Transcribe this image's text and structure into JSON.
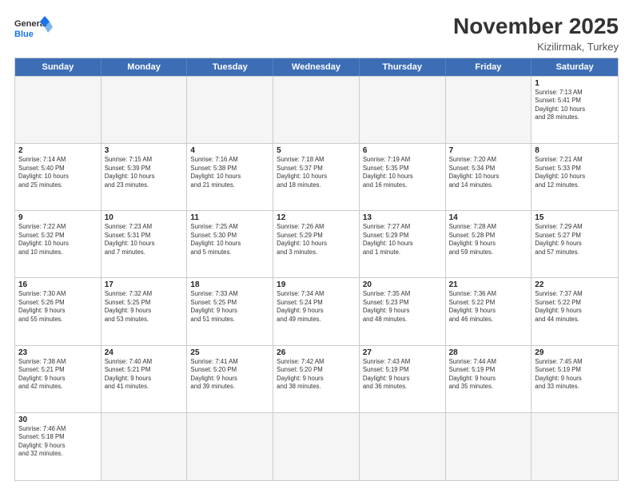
{
  "header": {
    "logo_general": "General",
    "logo_blue": "Blue",
    "month_title": "November 2025",
    "subtitle": "Kizilirmak, Turkey"
  },
  "weekdays": [
    "Sunday",
    "Monday",
    "Tuesday",
    "Wednesday",
    "Thursday",
    "Friday",
    "Saturday"
  ],
  "rows": [
    [
      {
        "day": "",
        "info": ""
      },
      {
        "day": "",
        "info": ""
      },
      {
        "day": "",
        "info": ""
      },
      {
        "day": "",
        "info": ""
      },
      {
        "day": "",
        "info": ""
      },
      {
        "day": "",
        "info": ""
      },
      {
        "day": "1",
        "info": "Sunrise: 7:13 AM\nSunset: 5:41 PM\nDaylight: 10 hours\nand 28 minutes."
      }
    ],
    [
      {
        "day": "2",
        "info": "Sunrise: 7:14 AM\nSunset: 5:40 PM\nDaylight: 10 hours\nand 25 minutes."
      },
      {
        "day": "3",
        "info": "Sunrise: 7:15 AM\nSunset: 5:39 PM\nDaylight: 10 hours\nand 23 minutes."
      },
      {
        "day": "4",
        "info": "Sunrise: 7:16 AM\nSunset: 5:38 PM\nDaylight: 10 hours\nand 21 minutes."
      },
      {
        "day": "5",
        "info": "Sunrise: 7:18 AM\nSunset: 5:37 PM\nDaylight: 10 hours\nand 18 minutes."
      },
      {
        "day": "6",
        "info": "Sunrise: 7:19 AM\nSunset: 5:35 PM\nDaylight: 10 hours\nand 16 minutes."
      },
      {
        "day": "7",
        "info": "Sunrise: 7:20 AM\nSunset: 5:34 PM\nDaylight: 10 hours\nand 14 minutes."
      },
      {
        "day": "8",
        "info": "Sunrise: 7:21 AM\nSunset: 5:33 PM\nDaylight: 10 hours\nand 12 minutes."
      }
    ],
    [
      {
        "day": "9",
        "info": "Sunrise: 7:22 AM\nSunset: 5:32 PM\nDaylight: 10 hours\nand 10 minutes."
      },
      {
        "day": "10",
        "info": "Sunrise: 7:23 AM\nSunset: 5:31 PM\nDaylight: 10 hours\nand 7 minutes."
      },
      {
        "day": "11",
        "info": "Sunrise: 7:25 AM\nSunset: 5:30 PM\nDaylight: 10 hours\nand 5 minutes."
      },
      {
        "day": "12",
        "info": "Sunrise: 7:26 AM\nSunset: 5:29 PM\nDaylight: 10 hours\nand 3 minutes."
      },
      {
        "day": "13",
        "info": "Sunrise: 7:27 AM\nSunset: 5:29 PM\nDaylight: 10 hours\nand 1 minute."
      },
      {
        "day": "14",
        "info": "Sunrise: 7:28 AM\nSunset: 5:28 PM\nDaylight: 9 hours\nand 59 minutes."
      },
      {
        "day": "15",
        "info": "Sunrise: 7:29 AM\nSunset: 5:27 PM\nDaylight: 9 hours\nand 57 minutes."
      }
    ],
    [
      {
        "day": "16",
        "info": "Sunrise: 7:30 AM\nSunset: 5:26 PM\nDaylight: 9 hours\nand 55 minutes."
      },
      {
        "day": "17",
        "info": "Sunrise: 7:32 AM\nSunset: 5:25 PM\nDaylight: 9 hours\nand 53 minutes."
      },
      {
        "day": "18",
        "info": "Sunrise: 7:33 AM\nSunset: 5:25 PM\nDaylight: 9 hours\nand 51 minutes."
      },
      {
        "day": "19",
        "info": "Sunrise: 7:34 AM\nSunset: 5:24 PM\nDaylight: 9 hours\nand 49 minutes."
      },
      {
        "day": "20",
        "info": "Sunrise: 7:35 AM\nSunset: 5:23 PM\nDaylight: 9 hours\nand 48 minutes."
      },
      {
        "day": "21",
        "info": "Sunrise: 7:36 AM\nSunset: 5:22 PM\nDaylight: 9 hours\nand 46 minutes."
      },
      {
        "day": "22",
        "info": "Sunrise: 7:37 AM\nSunset: 5:22 PM\nDaylight: 9 hours\nand 44 minutes."
      }
    ],
    [
      {
        "day": "23",
        "info": "Sunrise: 7:38 AM\nSunset: 5:21 PM\nDaylight: 9 hours\nand 42 minutes."
      },
      {
        "day": "24",
        "info": "Sunrise: 7:40 AM\nSunset: 5:21 PM\nDaylight: 9 hours\nand 41 minutes."
      },
      {
        "day": "25",
        "info": "Sunrise: 7:41 AM\nSunset: 5:20 PM\nDaylight: 9 hours\nand 39 minutes."
      },
      {
        "day": "26",
        "info": "Sunrise: 7:42 AM\nSunset: 5:20 PM\nDaylight: 9 hours\nand 38 minutes."
      },
      {
        "day": "27",
        "info": "Sunrise: 7:43 AM\nSunset: 5:19 PM\nDaylight: 9 hours\nand 36 minutes."
      },
      {
        "day": "28",
        "info": "Sunrise: 7:44 AM\nSunset: 5:19 PM\nDaylight: 9 hours\nand 35 minutes."
      },
      {
        "day": "29",
        "info": "Sunrise: 7:45 AM\nSunset: 5:19 PM\nDaylight: 9 hours\nand 33 minutes."
      }
    ],
    [
      {
        "day": "30",
        "info": "Sunrise: 7:46 AM\nSunset: 5:18 PM\nDaylight: 9 hours\nand 32 minutes."
      },
      {
        "day": "",
        "info": ""
      },
      {
        "day": "",
        "info": ""
      },
      {
        "day": "",
        "info": ""
      },
      {
        "day": "",
        "info": ""
      },
      {
        "day": "",
        "info": ""
      },
      {
        "day": "",
        "info": ""
      }
    ]
  ]
}
